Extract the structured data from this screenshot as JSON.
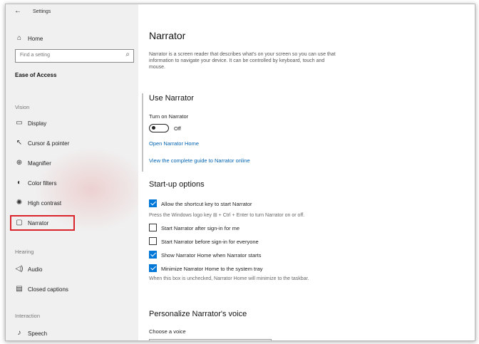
{
  "window": {
    "back_glyph": "←",
    "title": "Settings"
  },
  "sidebar": {
    "home": {
      "icon": "home-icon",
      "label": "Home"
    },
    "search_placeholder": "Find a setting",
    "section_title": "Ease of Access",
    "groups": {
      "vision": "Vision",
      "hearing": "Hearing",
      "interaction": "Interaction"
    },
    "items": [
      {
        "icon": "display-icon",
        "label": "Display"
      },
      {
        "icon": "cursor-pointer-icon",
        "label": "Cursor & pointer"
      },
      {
        "icon": "magnifier-icon",
        "label": "Magnifier"
      },
      {
        "icon": "color-filters-icon",
        "label": "Color filters"
      },
      {
        "icon": "high-contrast-icon",
        "label": "High contrast"
      },
      {
        "icon": "narrator-icon",
        "label": "Narrator"
      },
      {
        "icon": "audio-icon",
        "label": "Audio"
      },
      {
        "icon": "closed-captions-icon",
        "label": "Closed captions"
      },
      {
        "icon": "speech-icon",
        "label": "Speech"
      }
    ],
    "highlight_color": "#d9242b"
  },
  "main": {
    "title": "Narrator",
    "description": "Narrator is a screen reader that describes what's on your screen so you can use that information to navigate your device. It can be controlled by keyboard, touch and mouse.",
    "use_narrator": {
      "heading": "Use Narrator",
      "toggle_label": "Turn on Narrator",
      "toggle_state": "Off",
      "link_home": "Open Narrator Home",
      "link_guide": "View the complete guide to Narrator online"
    },
    "startup": {
      "heading": "Start-up options",
      "options": [
        {
          "label": "Allow the shortcut key to start Narrator",
          "checked": true
        },
        {
          "label": "Start Narrator after sign-in for me",
          "checked": false
        },
        {
          "label": "Start Narrator before sign-in for everyone",
          "checked": false
        },
        {
          "label": "Show Narrator Home when Narrator starts",
          "checked": true
        },
        {
          "label": "Minimize Narrator Home to the system tray",
          "checked": true
        }
      ],
      "shortcut_hint": "Press the Windows logo key ⊞ + Ctrl + Enter to turn Narrator on or off.",
      "minimize_hint": "When this box is unchecked, Narrator Home will minimize to the taskbar."
    },
    "voice": {
      "heading": "Personalize Narrator's voice",
      "choose_label": "Choose a voice"
    }
  },
  "colors": {
    "accent": "#0078d7",
    "link": "#0063b1"
  }
}
